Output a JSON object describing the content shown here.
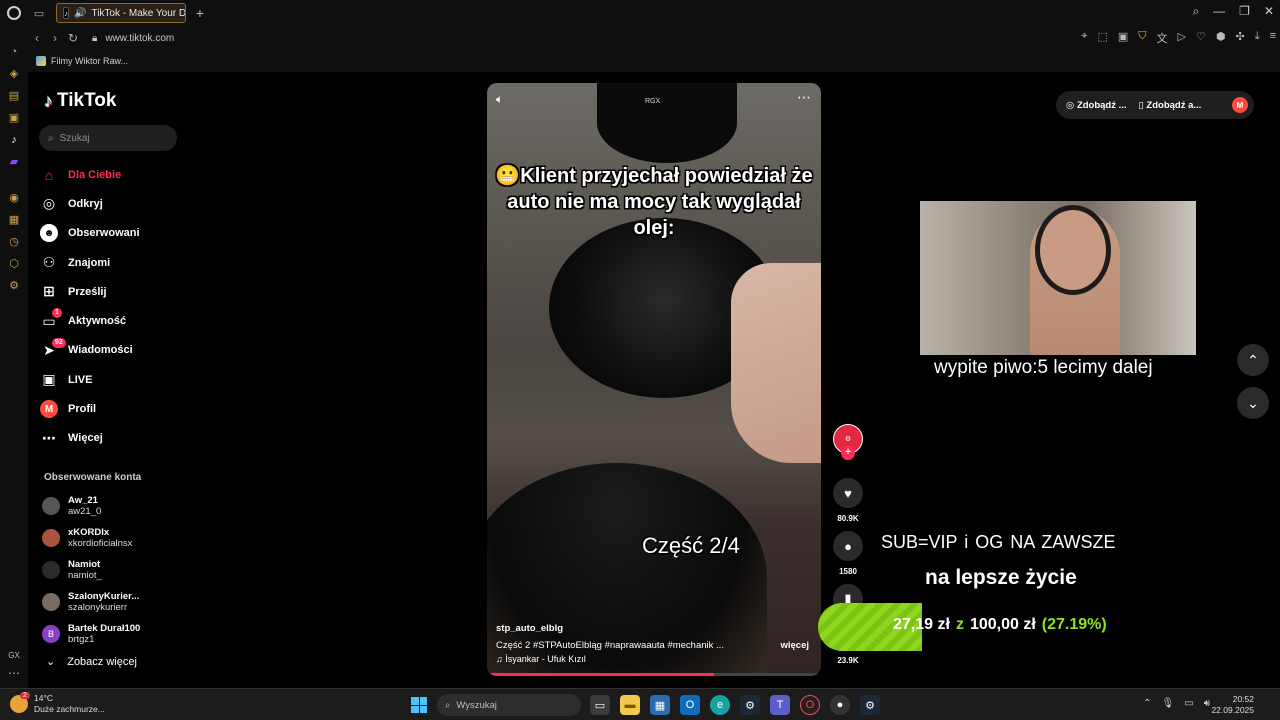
{
  "browser": {
    "tab_title": "TikTok - Make Your D...",
    "url": "www.tiktok.com",
    "bookmark": "Filmy Wiktor Raw...",
    "gx_label": "GX"
  },
  "tiktok": {
    "logo_text": "TikTok",
    "search_placeholder": "Szukaj",
    "menu": [
      {
        "label": "Dla Ciebie",
        "icon": "home-icon"
      },
      {
        "label": "Odkryj",
        "icon": "compass-icon"
      },
      {
        "label": "Obserwowani",
        "icon": "following-icon"
      },
      {
        "label": "Znajomi",
        "icon": "friends-icon"
      },
      {
        "label": "Prześlij",
        "icon": "upload-icon"
      },
      {
        "label": "Aktywność",
        "icon": "activity-icon",
        "badge": "1"
      },
      {
        "label": "Wiadomości",
        "icon": "messages-icon",
        "badge": "92"
      },
      {
        "label": "LIVE",
        "icon": "live-icon"
      },
      {
        "label": "Profil",
        "icon": "profile-icon",
        "avatar": "M"
      },
      {
        "label": "Więcej",
        "icon": "more-icon"
      }
    ],
    "followed_header": "Obserwowane konta",
    "followed": [
      {
        "name": "Aw_21",
        "handle": "aw21_0"
      },
      {
        "name": "xKORDIx",
        "handle": "xkordioficialnsx"
      },
      {
        "name": "Namiot",
        "handle": "namiot_"
      },
      {
        "name": "SzalonyKurier...",
        "handle": "szalonykurierr"
      },
      {
        "name": "Bartek Durał100",
        "handle": "brtgz1",
        "avatar": "B"
      }
    ],
    "see_more": "Zobacz więcej",
    "top_right": {
      "item1": "Zdobądź ...",
      "item2": "Zdobądź a...",
      "avatar": "M"
    }
  },
  "video": {
    "watermark": "RGX",
    "caption": "😬Klient przyjechał powiedział że auto nie ma mocy tak wyglądał olej:",
    "part_label": "Część 2/4",
    "author": "stp_auto_elblg",
    "description": "Część 2 #STPAutoElbląg #naprawaauta #mechanik ...",
    "more_label": "więcej",
    "music": "♫ İsyankar - Ufuk Kızıl",
    "progress": 0.68,
    "likes": "80.9K",
    "comments": "1580",
    "shares": "23.9K"
  },
  "overlay": {
    "beer": "wypite piwo:5 lecimy dalej",
    "sub": "SUB=VIP i OG   NA ZAWSZE",
    "better": "na lepsze życie",
    "goal_current": "27,19 zł",
    "goal_z": "z",
    "goal_target": "100,00 zł",
    "goal_pct": "(27.19%)",
    "goal_fraction": 0.2719
  },
  "taskbar": {
    "temp": "14°C",
    "weather_desc": "Duże zachmurze...",
    "weather_badge": "2",
    "search_placeholder": "Wyszukaj",
    "time": "20:52",
    "date": "22.09.2025"
  }
}
